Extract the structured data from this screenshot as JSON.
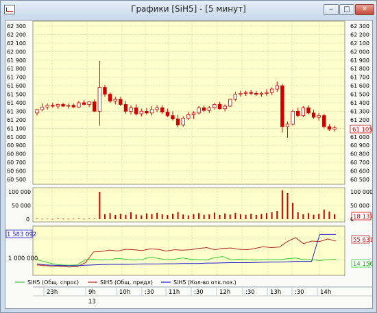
{
  "window": {
    "title": "Графики [SiH5] - [5 минут]",
    "minimize_glyph": "‒",
    "maximize_glyph": "□",
    "close_glyph": "✕"
  },
  "colors": {
    "plot_bg": "#ffffcc",
    "grid": "#c8c8a0",
    "candle": "#cc0000",
    "volume": "#cc0000",
    "demand": "#33cc33",
    "supply": "#b22222",
    "open_interest": "#1a1acc"
  },
  "price_panel": {
    "y_ticks": [
      "62 300",
      "62 200",
      "62 100",
      "62 000",
      "61 900",
      "61 800",
      "61 700",
      "61 600",
      "61 500",
      "61 400",
      "61 300",
      "61 200",
      "61 100",
      "61 000",
      "60 900",
      "60 800",
      "60 700",
      "60 600",
      "60 500"
    ],
    "last_price_label": "61 105"
  },
  "volume_panel": {
    "y_ticks": [
      "100 000",
      "50 000",
      "0"
    ],
    "last_volume_label": "18 137"
  },
  "indicator_panel": {
    "left_top_label": "1 583 092",
    "left_mid_label": "1 000 000",
    "right_red_label": "55 631",
    "right_green_label": "14 156"
  },
  "legend": [
    {
      "name": "SiH5 (Общ. спрос)",
      "color": "#33cc33"
    },
    {
      "name": "SiH5 (Общ. предл)",
      "color": "#b22222"
    },
    {
      "name": "SiH5 (Кол-во отк.поз.)",
      "color": "#1a1acc"
    }
  ],
  "time_axis": {
    "labels": [
      "23h",
      "9h",
      "10h",
      ":30",
      "11h",
      ":30",
      "12h",
      ":30",
      "13h",
      ":30",
      "14h"
    ],
    "date_label": "13"
  },
  "chart_data": {
    "type": "candlestick",
    "title": "",
    "ylim": [
      60500,
      62300
    ],
    "candles": [
      {
        "o": 61280,
        "h": 61330,
        "l": 61250,
        "c": 61320
      },
      {
        "o": 61320,
        "h": 61390,
        "l": 61300,
        "c": 61350
      },
      {
        "o": 61350,
        "h": 61390,
        "l": 61320,
        "c": 61370
      },
      {
        "o": 61370,
        "h": 61400,
        "l": 61340,
        "c": 61360
      },
      {
        "o": 61360,
        "h": 61390,
        "l": 61330,
        "c": 61380
      },
      {
        "o": 61380,
        "h": 61400,
        "l": 61350,
        "c": 61360
      },
      {
        "o": 61360,
        "h": 61390,
        "l": 61330,
        "c": 61370
      },
      {
        "o": 61370,
        "h": 61390,
        "l": 61340,
        "c": 61350
      },
      {
        "o": 61350,
        "h": 61420,
        "l": 61340,
        "c": 61400
      },
      {
        "o": 61400,
        "h": 61430,
        "l": 61370,
        "c": 61380
      },
      {
        "o": 61380,
        "h": 61410,
        "l": 61350,
        "c": 61410
      },
      {
        "o": 61410,
        "h": 61440,
        "l": 61290,
        "c": 61300
      },
      {
        "o": 61300,
        "h": 61890,
        "l": 61130,
        "c": 61580
      },
      {
        "o": 61580,
        "h": 61610,
        "l": 61470,
        "c": 61500
      },
      {
        "o": 61500,
        "h": 61520,
        "l": 61400,
        "c": 61420
      },
      {
        "o": 61420,
        "h": 61470,
        "l": 61380,
        "c": 61440
      },
      {
        "o": 61440,
        "h": 61470,
        "l": 61360,
        "c": 61380
      },
      {
        "o": 61380,
        "h": 61420,
        "l": 61270,
        "c": 61300
      },
      {
        "o": 61300,
        "h": 61370,
        "l": 61260,
        "c": 61340
      },
      {
        "o": 61340,
        "h": 61380,
        "l": 61250,
        "c": 61270
      },
      {
        "o": 61270,
        "h": 61330,
        "l": 61240,
        "c": 61300
      },
      {
        "o": 61300,
        "h": 61340,
        "l": 61260,
        "c": 61280
      },
      {
        "o": 61280,
        "h": 61360,
        "l": 61250,
        "c": 61320
      },
      {
        "o": 61320,
        "h": 61370,
        "l": 61290,
        "c": 61340
      },
      {
        "o": 61340,
        "h": 61370,
        "l": 61270,
        "c": 61290
      },
      {
        "o": 61290,
        "h": 61330,
        "l": 61230,
        "c": 61250
      },
      {
        "o": 61250,
        "h": 61300,
        "l": 61190,
        "c": 61210
      },
      {
        "o": 61210,
        "h": 61260,
        "l": 61110,
        "c": 61140
      },
      {
        "o": 61140,
        "h": 61240,
        "l": 61120,
        "c": 61220
      },
      {
        "o": 61220,
        "h": 61290,
        "l": 61200,
        "c": 61260
      },
      {
        "o": 61260,
        "h": 61300,
        "l": 61210,
        "c": 61280
      },
      {
        "o": 61280,
        "h": 61360,
        "l": 61260,
        "c": 61340
      },
      {
        "o": 61340,
        "h": 61370,
        "l": 61290,
        "c": 61310
      },
      {
        "o": 61310,
        "h": 61360,
        "l": 61280,
        "c": 61340
      },
      {
        "o": 61340,
        "h": 61400,
        "l": 61320,
        "c": 61380
      },
      {
        "o": 61380,
        "h": 61410,
        "l": 61320,
        "c": 61330
      },
      {
        "o": 61330,
        "h": 61380,
        "l": 61300,
        "c": 61360
      },
      {
        "o": 61360,
        "h": 61450,
        "l": 61350,
        "c": 61440
      },
      {
        "o": 61440,
        "h": 61530,
        "l": 61420,
        "c": 61500
      },
      {
        "o": 61500,
        "h": 61540,
        "l": 61470,
        "c": 61510
      },
      {
        "o": 61510,
        "h": 61540,
        "l": 61480,
        "c": 61520
      },
      {
        "o": 61520,
        "h": 61550,
        "l": 61490,
        "c": 61510
      },
      {
        "o": 61510,
        "h": 61540,
        "l": 61480,
        "c": 61500
      },
      {
        "o": 61500,
        "h": 61530,
        "l": 61470,
        "c": 61510
      },
      {
        "o": 61510,
        "h": 61560,
        "l": 61480,
        "c": 61520
      },
      {
        "o": 61520,
        "h": 61580,
        "l": 61490,
        "c": 61560
      },
      {
        "o": 61560,
        "h": 61650,
        "l": 61530,
        "c": 61600
      },
      {
        "o": 61600,
        "h": 61620,
        "l": 61050,
        "c": 61120
      },
      {
        "o": 61120,
        "h": 61180,
        "l": 60990,
        "c": 61150
      },
      {
        "o": 61150,
        "h": 61320,
        "l": 61130,
        "c": 61300
      },
      {
        "o": 61300,
        "h": 61340,
        "l": 61230,
        "c": 61250
      },
      {
        "o": 61250,
        "h": 61360,
        "l": 61230,
        "c": 61340
      },
      {
        "o": 61340,
        "h": 61370,
        "l": 61260,
        "c": 61280
      },
      {
        "o": 61280,
        "h": 61320,
        "l": 61210,
        "c": 61230
      },
      {
        "o": 61230,
        "h": 61280,
        "l": 61190,
        "c": 61250
      },
      {
        "o": 61250,
        "h": 61270,
        "l": 61100,
        "c": 61120
      },
      {
        "o": 61120,
        "h": 61150,
        "l": 61070,
        "c": 61090
      },
      {
        "o": 61090,
        "h": 61130,
        "l": 61060,
        "c": 61105
      }
    ],
    "volumes": [
      2000,
      1500,
      1800,
      1200,
      2500,
      1600,
      1400,
      1700,
      2100,
      1300,
      1900,
      2400,
      100000,
      18000,
      22000,
      15000,
      20000,
      16000,
      25000,
      17000,
      14000,
      21000,
      19000,
      23000,
      18000,
      15000,
      20000,
      26000,
      17000,
      14000,
      19000,
      22000,
      16000,
      18000,
      24000,
      15000,
      21000,
      17000,
      23000,
      18000,
      16000,
      20000,
      15000,
      19000,
      22000,
      25000,
      30000,
      105000,
      95000,
      60000,
      25000,
      18000,
      22000,
      16000,
      20000,
      35000,
      28000,
      18137
    ],
    "volume_ylim": [
      0,
      100000
    ],
    "indicator_series": [
      {
        "name": "SiH5 (Общ. спрос)",
        "color": "#33cc33",
        "values": [
          1000000,
          950000,
          900000,
          880000,
          870000,
          880000,
          1000000,
          1010000,
          990000,
          1000000,
          1030000,
          1010000,
          990000,
          1000000,
          1060000,
          1030000,
          1000000,
          1010000,
          1040000,
          1010000,
          1000000,
          990000,
          1050000,
          1070000,
          1000000,
          1010000,
          1000000,
          990000,
          1000000,
          1000000,
          1000000,
          1020000,
          1040000,
          1000000,
          1000000,
          980000,
          1000000,
          1010000
        ]
      },
      {
        "name": "SiH5 (Общ. предл)",
        "color": "#b22222",
        "values": [
          880000,
          860000,
          850000,
          840000,
          830000,
          840000,
          930000,
          1180000,
          1190000,
          1220000,
          1200000,
          1240000,
          1230000,
          1210000,
          1250000,
          1240000,
          1200000,
          1230000,
          1220000,
          1230000,
          1260000,
          1280000,
          1230000,
          1260000,
          1270000,
          1240000,
          1230000,
          1260000,
          1300000,
          1280000,
          1290000,
          1420000,
          1510000,
          1370000,
          1430000,
          1420000,
          1480000,
          1430000
        ]
      },
      {
        "name": "SiH5 (Кол-во отк.поз.)",
        "color": "#1a1acc",
        "values": [
          900000,
          880000,
          870000,
          865000,
          860000,
          860000,
          870000,
          880000,
          885000,
          890000,
          890000,
          890000,
          895000,
          900000,
          900000,
          900000,
          905000,
          905000,
          910000,
          910000,
          910000,
          920000,
          920000,
          925000,
          930000,
          930000,
          930000,
          935000,
          940000,
          945000,
          945000,
          950000,
          960000,
          960000,
          960000,
          1583092,
          1583092,
          1583092
        ]
      }
    ]
  }
}
